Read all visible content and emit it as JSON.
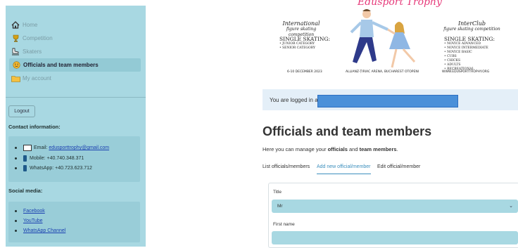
{
  "sidebar": {
    "nav": [
      {
        "label": "Home",
        "icon": "home-icon"
      },
      {
        "label": "Competition",
        "icon": "trophy-icon"
      },
      {
        "label": "Skaters",
        "icon": "skate-icon"
      },
      {
        "label": "Officials and team members",
        "icon": "smiley-icon"
      },
      {
        "label": "My account",
        "icon": "folder-icon"
      }
    ],
    "logout_label": "Logout",
    "contact_title": "Contact information:",
    "contact": {
      "email_prefix": "Email: ",
      "email": "edusporttrophy@gmail.com",
      "mobile": "Mobile: +40.740.348.371",
      "whatsapp": "WhatsApp: +40.723.623.712"
    },
    "social_title": "Social media:",
    "social": [
      "Facebook",
      "YouTube",
      "WhatsApp Channel"
    ]
  },
  "banner": {
    "title": "Edusport Trophy",
    "left_title_1": "International",
    "left_title_2": "figure skating competition",
    "left_sk_title": "SINGLE SKATING:",
    "left_sk_items": [
      "• JUNIOR CATEGORY",
      "• SENIOR CATEGORY"
    ],
    "right_title_1": "InterClub",
    "right_title_2": "figure skating competition",
    "right_sk_title": "SINGLE SKATING:",
    "right_sk_items": [
      "• NOVICE ADVANCED",
      "• NOVICE INTERMEDIATE",
      "• NOVICE BASIC",
      "• CUBS",
      "• CHICKS",
      "• ADULTS",
      "• RECREATIONAL"
    ],
    "dates": "6-10 DECEMBER 2023",
    "venue": "ALLIANZ-ȚIRIAC ARENA, BUCHAREST OTOPENI",
    "website": "WWW.EDUSPORTTROPHY.ORG"
  },
  "alert": {
    "text": "You are logged in as"
  },
  "page": {
    "title": "Officials and team members",
    "desc_1": "Here you can manage your ",
    "desc_b1": "officials",
    "desc_2": " and ",
    "desc_b2": "team members",
    "desc_3": "."
  },
  "tabs": [
    "List officials/members",
    "Add new official/member",
    "Edit official/member"
  ],
  "form": {
    "title_label": "Title",
    "title_value": "Mr",
    "first_name_label": "First name",
    "first_name_value": ""
  },
  "colors": {
    "sidebar": "#a8d8e2",
    "accent": "#3c8fbd",
    "banner_title": "#e63a7a"
  }
}
